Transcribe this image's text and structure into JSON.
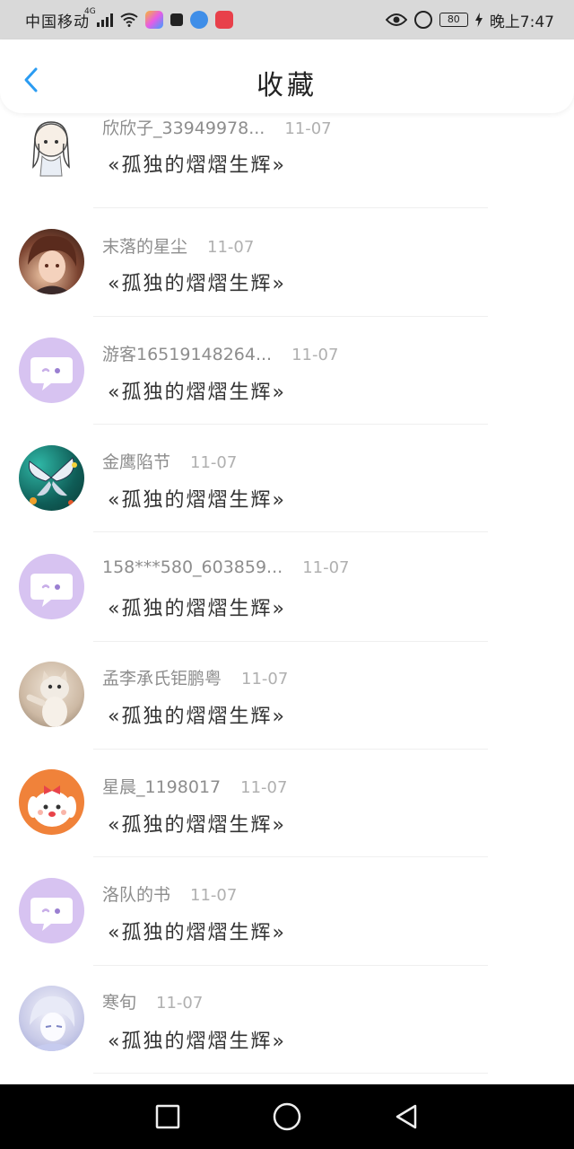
{
  "status_bar": {
    "carrier": "中国移动",
    "network": "4G",
    "battery": "80",
    "time": "晚上7:47"
  },
  "header": {
    "title": "收藏",
    "back_icon": "chevron-left-icon",
    "accent": "#2b9cf2"
  },
  "items": [
    {
      "user": "欣欣子_33949978...",
      "date": "11-07",
      "book": "«孤独的熠熠生辉»",
      "avatar": "avatar-girl"
    },
    {
      "user": "末落的星尘",
      "date": "11-07",
      "book": "«孤独的熠熠生辉»",
      "avatar": "avatar-boy"
    },
    {
      "user": "游客16519148264...",
      "date": "11-07",
      "book": "«孤独的熠熠生辉»",
      "avatar": "avatar-default"
    },
    {
      "user": "金鹰陷节",
      "date": "11-07",
      "book": "«孤独的熠熠生辉»",
      "avatar": "avatar-butterfly"
    },
    {
      "user": "158***580_603859...",
      "date": "11-07",
      "book": "«孤独的熠熠生辉»",
      "avatar": "avatar-default"
    },
    {
      "user": "孟李承氏钜鹏粤",
      "date": "11-07",
      "book": "«孤独的熠熠生辉»",
      "avatar": "avatar-cat"
    },
    {
      "user": "星晨_1198017",
      "date": "11-07",
      "book": "«孤独的熠熠生辉»",
      "avatar": "avatar-dog"
    },
    {
      "user": "洛队的书",
      "date": "11-07",
      "book": "«孤独的熠熠生辉»",
      "avatar": "avatar-default"
    },
    {
      "user": "寒旬",
      "date": "11-07",
      "book": "«孤独的熠熠生辉»",
      "avatar": "avatar-anime"
    }
  ],
  "nav_bar": {
    "recent_icon": "square-icon",
    "home_icon": "circle-icon",
    "back_icon": "triangle-back-icon"
  }
}
